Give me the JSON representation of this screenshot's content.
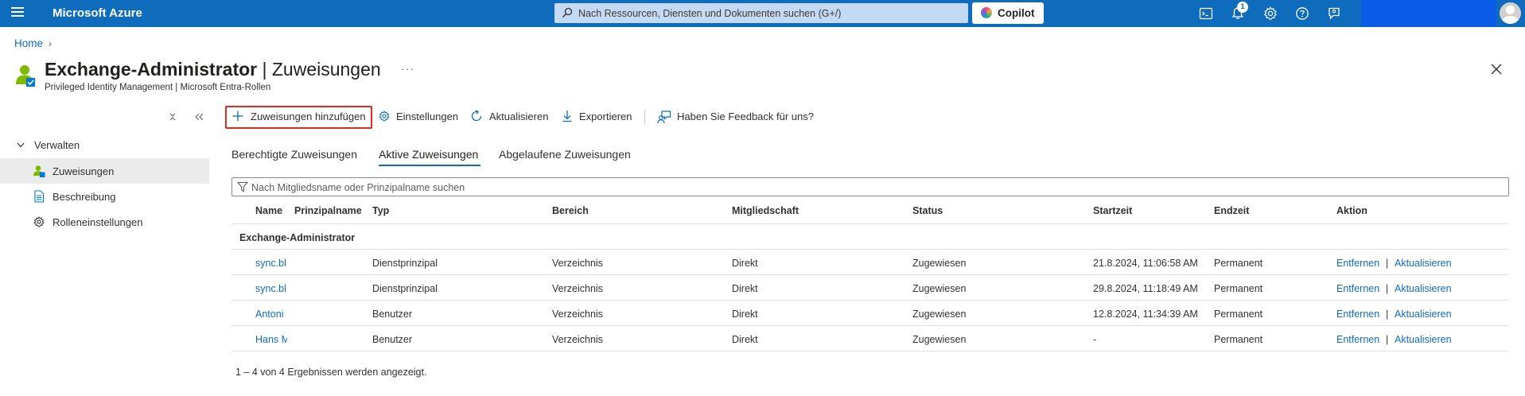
{
  "topbar": {
    "brand": "Microsoft Azure",
    "search_placeholder": "Nach Ressourcen, Diensten und Dokumenten suchen (G+/)",
    "copilot_label": "Copilot",
    "notification_count": "1",
    "accent_color": "#0f6cbd",
    "icons": [
      "menu-icon",
      "search-icon",
      "copilot-icon",
      "cloud-shell-icon",
      "notifications-icon",
      "settings-icon",
      "help-icon",
      "feedback-icon",
      "avatar"
    ]
  },
  "breadcrumb": {
    "home": "Home",
    "separator": "›"
  },
  "header": {
    "title_bold": "Exchange-Administrator",
    "title_rest": " | Zuweisungen",
    "subtitle": "Privileged Identity Management | Microsoft Entra-Rollen",
    "more": "···"
  },
  "sidebar": {
    "group_label": "Verwalten",
    "items": [
      {
        "label": "Zuweisungen",
        "icon": "user-assign-icon",
        "selected": true
      },
      {
        "label": "Beschreibung",
        "icon": "document-icon",
        "selected": false
      },
      {
        "label": "Rolleneinstellungen",
        "icon": "gear-icon",
        "selected": false
      }
    ]
  },
  "toolbar": {
    "add_label": "Zuweisungen hinzufügen",
    "settings_label": "Einstellungen",
    "refresh_label": "Aktualisieren",
    "export_label": "Exportieren",
    "feedback_label": "Haben Sie Feedback für uns?"
  },
  "tabs": [
    {
      "label": "Berechtigte Zuweisungen",
      "active": false
    },
    {
      "label": "Aktive Zuweisungen",
      "active": true
    },
    {
      "label": "Abgelaufene Zuweisungen",
      "active": false
    }
  ],
  "filter": {
    "placeholder": "Nach Mitgliedsname oder Prinzipalname suchen"
  },
  "table": {
    "columns": [
      "Name",
      "Prinzipalname",
      "Typ",
      "Bereich",
      "Mitgliedschaft",
      "Status",
      "Startzeit",
      "Endzeit",
      "Aktion"
    ],
    "group": "Exchange-Administrator",
    "rows": [
      {
        "name": "sync.bl",
        "principal": "",
        "type": "Dienstprinzipal",
        "scope": "Verzeichnis",
        "membership": "Direkt",
        "status": "Zugewiesen",
        "start": "21.8.2024, 11:06:58 AM",
        "end": "Permanent",
        "action_remove": "Entfernen",
        "action_separator": "|",
        "action_update": "Aktualisieren"
      },
      {
        "name": "sync.bl",
        "principal": "",
        "type": "Dienstprinzipal",
        "scope": "Verzeichnis",
        "membership": "Direkt",
        "status": "Zugewiesen",
        "start": "29.8.2024, 11:18:49 AM",
        "end": "Permanent",
        "action_remove": "Entfernen",
        "action_separator": "|",
        "action_update": "Aktualisieren"
      },
      {
        "name": "Antoni",
        "principal": "",
        "type": "Benutzer",
        "scope": "Verzeichnis",
        "membership": "Direkt",
        "status": "Zugewiesen",
        "start": "12.8.2024, 11:34:39 AM",
        "end": "Permanent",
        "action_remove": "Entfernen",
        "action_separator": "|",
        "action_update": "Aktualisieren"
      },
      {
        "name": "Hans M",
        "principal": "",
        "type": "Benutzer",
        "scope": "Verzeichnis",
        "membership": "Direkt",
        "status": "Zugewiesen",
        "start": "-",
        "end": "Permanent",
        "action_remove": "Entfernen",
        "action_separator": "|",
        "action_update": "Aktualisieren"
      }
    ]
  },
  "footer": {
    "result_text": "1 – 4 von 4 Ergebnissen werden angezeigt."
  }
}
